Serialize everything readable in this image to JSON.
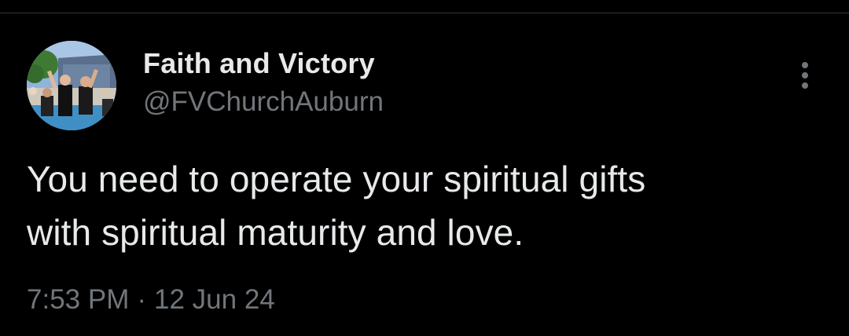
{
  "tweet": {
    "author": {
      "display_name": "Faith and Victory",
      "handle": "@FVChurchAuburn",
      "avatar_icon": "profile-photo"
    },
    "text_lines": [
      "You need to operate your spiritual gifts",
      "with spiritual maturity and love."
    ],
    "time": "7:53 PM",
    "separator": "·",
    "date": "12 Jun 24",
    "more_icon": "more-vertical-icon"
  },
  "colors": {
    "background": "#000000",
    "primary_text": "#e7e9ea",
    "secondary_text": "#71767b",
    "divider": "#2f3336"
  }
}
